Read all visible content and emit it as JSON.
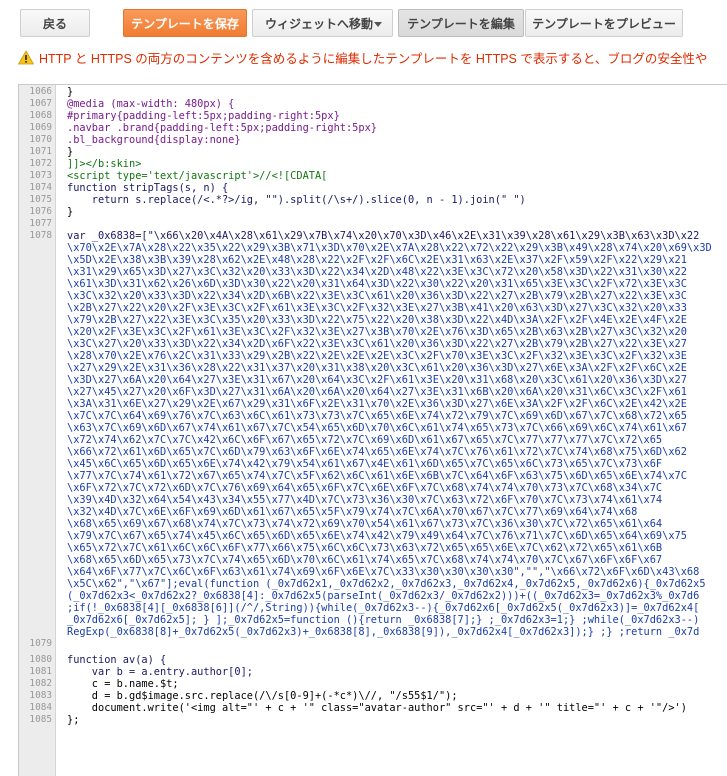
{
  "toolbar": {
    "back": "戻る",
    "save": "テンプレートを保存",
    "jump": "ウィジェットへ移動",
    "edit": "テンプレートを編集",
    "preview": "テンプレートをプレビュー"
  },
  "warning": {
    "text": "HTTP と HTTPS の両方のコンテンツを含めるように編集したテンプレートを HTTPS で表示すると、ブログの安全性や"
  },
  "colors": {
    "accent": "#f17c31",
    "warning": "#dd2c00",
    "gutter": "#ececec"
  },
  "editor": {
    "lines": [
      {
        "n": "1066",
        "t": "}"
      },
      {
        "n": "1067",
        "t": "@media (max-width: 480px) {"
      },
      {
        "n": "1068",
        "t": "#primary{padding-left:5px;padding-right:5px}"
      },
      {
        "n": "1069",
        "t": ".navbar .brand{padding-left:5px;padding-right:5px}"
      },
      {
        "n": "1070",
        "t": ".bl_background{display:none}"
      },
      {
        "n": "1071",
        "t": "}"
      },
      {
        "n": "1072",
        "t": "]]></b:skin>"
      },
      {
        "n": "1073",
        "t": "<script type='text/javascript'>//<![CDATA["
      },
      {
        "n": "1074",
        "t": "function stripTags(s, n) {"
      },
      {
        "n": "1075",
        "t": "    return s.replace(/<.*?>/ig, \"\").split(/\\s+/).slice(0, n - 1).join(\" \")"
      },
      {
        "n": "1076",
        "t": "}"
      },
      {
        "n": "1077",
        "t": ""
      },
      {
        "n": "1078",
        "t": "var _0x6838=[\"\\x66\\x20\\x4A\\x28\\x61\\x29\\x7B\\x74\\x20\\x70\\x3D\\x46\\x2E\\x31\\x39\\x28\\x61\\x29\\x3B\\x63\\x3D\\x22"
      },
      {
        "n": "",
        "t": "\\x70\\x2E\\x7A\\x28\\x22\\x35\\x22\\x29\\x3B\\x71\\x3D\\x70\\x2E\\x7A\\x28\\x22\\x72\\x22\\x29\\x3B\\x49\\x28\\x74\\x20\\x69\\x3D"
      },
      {
        "n": "",
        "t": "\\x5D\\x2E\\x38\\x3B\\x39\\x28\\x62\\x2E\\x48\\x28\\x22\\x2F\\x2F\\x6C\\x2E\\x31\\x63\\x2E\\x37\\x2F\\x59\\x2F\\x22\\x29\\x21"
      },
      {
        "n": "",
        "t": "\\x31\\x29\\x65\\x3D\\x27\\x3C\\x32\\x20\\x33\\x3D\\x22\\x34\\x2D\\x48\\x22\\x3E\\x3C\\x72\\x20\\x58\\x3D\\x22\\x31\\x30\\x22"
      },
      {
        "n": "",
        "t": "\\x61\\x3D\\x31\\x62\\x26\\x6D\\x3D\\x30\\x22\\x20\\x31\\x64\\x3D\\x22\\x30\\x22\\x20\\x31\\x65\\x3E\\x3C\\x2F\\x72\\x3E\\x3C"
      },
      {
        "n": "",
        "t": "\\x3C\\x32\\x20\\x33\\x3D\\x22\\x34\\x2D\\x6B\\x22\\x3E\\x3C\\x61\\x20\\x36\\x3D\\x22\\x27\\x2B\\x79\\x2B\\x27\\x22\\x3E\\x3C"
      },
      {
        "n": "",
        "t": "\\x2B\\x27\\x22\\x20\\x2F\\x3E\\x3C\\x2F\\x61\\x3E\\x3C\\x2F\\x32\\x3E\\x27\\x3B\\x41\\x20\\x63\\x3D\\x27\\x3C\\x32\\x20\\x33"
      },
      {
        "n": "",
        "t": "\\x79\\x2B\\x27\\x22\\x3E\\x3C\\x35\\x20\\x33\\x3D\\x22\\x75\\x22\\x20\\x38\\x3D\\x22\\x4D\\x3A\\x2F\\x2F\\x4E\\x2E\\x4F\\x2E"
      },
      {
        "n": "",
        "t": "\\x20\\x2F\\x3E\\x3C\\x2F\\x61\\x3E\\x3C\\x2F\\x32\\x3E\\x27\\x3B\\x70\\x2E\\x76\\x3D\\x65\\x2B\\x63\\x2B\\x27\\x3C\\x32\\x20"
      },
      {
        "n": "",
        "t": "\\x3C\\x27\\x20\\x33\\x3D\\x22\\x34\\x2D\\x6F\\x22\\x3E\\x3C\\x61\\x20\\x36\\x3D\\x22\\x27\\x2B\\x79\\x2B\\x27\\x22\\x3E\\x27"
      },
      {
        "n": "",
        "t": "\\x28\\x70\\x2E\\x76\\x2C\\x31\\x33\\x29\\x2B\\x22\\x2E\\x2E\\x2E\\x3C\\x2F\\x70\\x3E\\x3C\\x2F\\x32\\x3E\\x3C\\x2F\\x32\\x3E"
      },
      {
        "n": "",
        "t": "\\x27\\x29\\x2E\\x31\\x36\\x28\\x22\\x31\\x37\\x20\\x31\\x38\\x20\\x3C\\x61\\x20\\x36\\x3D\\x27\\x6E\\x3A\\x2F\\x2F\\x6C\\x2E"
      },
      {
        "n": "",
        "t": "\\x3D\\x27\\x6A\\x20\\x64\\x27\\x3E\\x31\\x67\\x20\\x64\\x3C\\x2F\\x61\\x3E\\x20\\x31\\x68\\x20\\x3C\\x61\\x20\\x36\\x3D\\x27"
      },
      {
        "n": "",
        "t": "\\x27\\x45\\x27\\x20\\x6F\\x3D\\x27\\x31\\x6A\\x20\\x6A\\x20\\x64\\x27\\x3E\\x31\\x6B\\x20\\x6A\\x20\\x31\\x6C\\x3C\\x2F\\x61"
      },
      {
        "n": "",
        "t": "\\x3A\\x31\\x6E\\x27\\x29\\x2E\\x67\\x29\\x31\\x6F\\x2E\\x31\\x70\\x2E\\x36\\x3D\\x27\\x6E\\x3A\\x2F\\x2F\\x6C\\x2E\\x42\\x2E"
      },
      {
        "n": "",
        "t": "\\x7C\\x7C\\x64\\x69\\x76\\x7C\\x63\\x6C\\x61\\x73\\x73\\x7C\\x65\\x6E\\x74\\x72\\x79\\x7C\\x69\\x6D\\x67\\x7C\\x68\\x72\\x65"
      },
      {
        "n": "",
        "t": "\\x63\\x7C\\x69\\x6D\\x67\\x74\\x61\\x67\\x7C\\x54\\x65\\x6D\\x70\\x6C\\x61\\x74\\x65\\x73\\x7C\\x66\\x69\\x6C\\x74\\x61\\x67"
      },
      {
        "n": "",
        "t": "\\x72\\x74\\x62\\x7C\\x7C\\x42\\x6C\\x6F\\x67\\x65\\x72\\x7C\\x69\\x6D\\x61\\x67\\x65\\x7C\\x77\\x77\\x77\\x7C\\x72\\x65"
      },
      {
        "n": "",
        "t": "\\x66\\x72\\x61\\x6D\\x65\\x7C\\x6D\\x79\\x63\\x6F\\x6E\\x74\\x65\\x6E\\x74\\x7C\\x76\\x61\\x72\\x7C\\x74\\x68\\x75\\x6D\\x62"
      },
      {
        "n": "",
        "t": "\\x45\\x6C\\x65\\x6D\\x65\\x6E\\x74\\x42\\x79\\x54\\x61\\x67\\x4E\\x61\\x6D\\x65\\x7C\\x65\\x6C\\x73\\x65\\x7C\\x73\\x6F"
      },
      {
        "n": "",
        "t": "\\x77\\x7C\\x74\\x61\\x72\\x67\\x65\\x74\\x7C\\x5F\\x62\\x6C\\x61\\x6E\\x6B\\x7C\\x64\\x6F\\x63\\x75\\x6D\\x65\\x6E\\x74\\x7C"
      },
      {
        "n": "",
        "t": "\\x6F\\x72\\x7C\\x72\\x6D\\x7C\\x76\\x69\\x64\\x65\\x6F\\x7C\\x6E\\x6F\\x7C\\x68\\x74\\x74\\x70\\x73\\x7C\\x68\\x34\\x7C"
      },
      {
        "n": "",
        "t": "\\x39\\x4D\\x32\\x64\\x54\\x43\\x34\\x55\\x77\\x4D\\x7C\\x73\\x36\\x30\\x7C\\x63\\x72\\x6F\\x70\\x7C\\x73\\x74\\x61\\x74"
      },
      {
        "n": "",
        "t": "\\x32\\x4D\\x7C\\x6E\\x6F\\x69\\x6D\\x61\\x67\\x65\\x5F\\x79\\x74\\x7C\\x6A\\x70\\x67\\x7C\\x77\\x69\\x64\\x74\\x68"
      },
      {
        "n": "",
        "t": "\\x68\\x65\\x69\\x67\\x68\\x74\\x7C\\x73\\x74\\x72\\x69\\x70\\x54\\x61\\x67\\x73\\x7C\\x36\\x30\\x7C\\x72\\x65\\x61\\x64"
      },
      {
        "n": "",
        "t": "\\x79\\x7C\\x67\\x65\\x74\\x45\\x6C\\x65\\x6D\\x65\\x6E\\x74\\x42\\x79\\x49\\x64\\x7C\\x76\\x71\\x7C\\x6D\\x65\\x64\\x69\\x75"
      },
      {
        "n": "",
        "t": "\\x65\\x72\\x7C\\x61\\x6C\\x6C\\x6F\\x77\\x66\\x75\\x6C\\x6C\\x73\\x63\\x72\\x65\\x65\\x6E\\x7C\\x62\\x72\\x65\\x61\\x6B"
      },
      {
        "n": "",
        "t": "\\x68\\x65\\x6D\\x65\\x73\\x7C\\x74\\x65\\x6D\\x70\\x6C\\x61\\x74\\x65\\x7C\\x68\\x74\\x74\\x70\\x7C\\x67\\x6F\\x6F\\x67"
      },
      {
        "n": "",
        "t": "\\x64\\x6F\\x77\\x7C\\x6C\\x6F\\x63\\x61\\x74\\x69\\x6F\\x6E\\x7C\\x33\\x30\\x30\\x30\\x30\",\"\",\"\\x66\\x72\\x6F\\x6D\\x43\\x68"
      },
      {
        "n": "",
        "t": "\\x5C\\x62\",\"\\x67\"];eval(function (_0x7d62x1,_0x7d62x2,_0x7d62x3,_0x7d62x4,_0x7d62x5,_0x7d62x6){_0x7d62x5"
      },
      {
        "n": "",
        "t": "(_0x7d62x3<_0x7d62x2?_0x6838[4]:_0x7d62x5(parseInt(_0x7d62x3/_0x7d62x2)))+((_0x7d62x3=_0x7d62x3%_0x7d6"
      },
      {
        "n": "",
        "t": ";if(!_0x6838[4][_0x6838[6]](/^/,String)){while(_0x7d62x3--){_0x7d62x6[_0x7d62x5(_0x7d62x3)]=_0x7d62x4["
      },
      {
        "n": "",
        "t": "_0x7d62x6[_0x7d62x5]; } ];_0x7d62x5=function (){return _0x6838[7];} ;_0x7d62x3=1;} ;while(_0x7d62x3--)"
      },
      {
        "n": "",
        "t": "RegExp(_0x6838[8]+_0x7d62x5(_0x7d62x3)+_0x6838[8],_0x6838[9]),_0x7d62x4[_0x7d62x3]);} ;} ;return _0x7d"
      },
      {
        "n": "1079",
        "t": ""
      },
      {
        "n": "1080",
        "t": "function av(a) {"
      },
      {
        "n": "1081",
        "t": "    var b = a.entry.author[0];"
      },
      {
        "n": "1082",
        "t": "    c = b.name.$t;"
      },
      {
        "n": "1083",
        "t": "    d = b.gd$image.src.replace(/\\/s[0-9]+(-*c*)\\//, \"/s55$1/\");"
      },
      {
        "n": "1084",
        "t": "    document.write('<img alt=\"' + c + '\" class=\"avatar-author\" src=\"' + d + '\" title=\"' + c + '\"/>')"
      },
      {
        "n": "1085",
        "t": "};"
      }
    ]
  }
}
